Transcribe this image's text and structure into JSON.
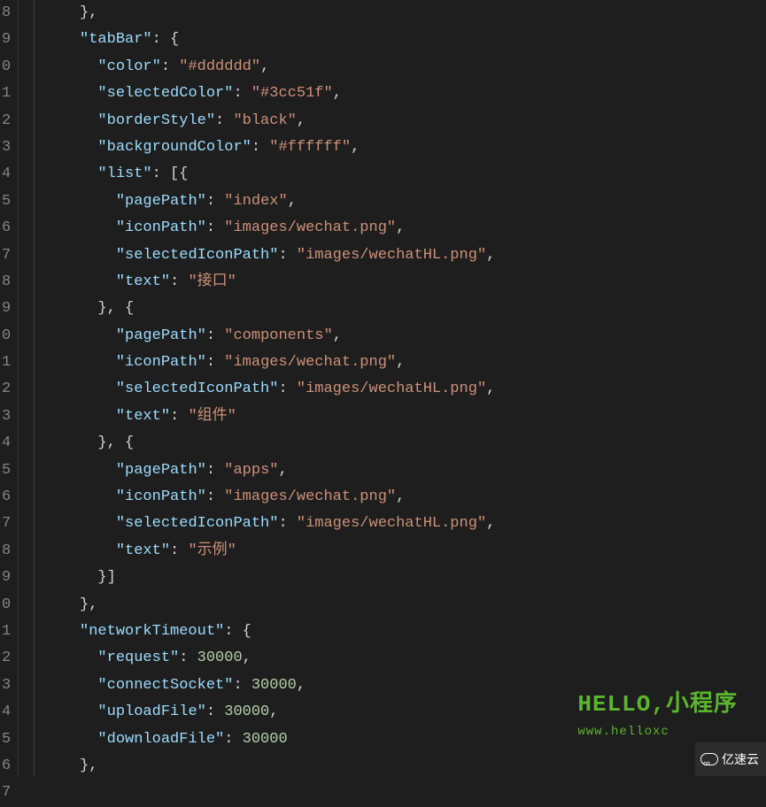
{
  "lineNumbers": [
    "8",
    "9",
    "0",
    "1",
    "2",
    "3",
    "4",
    "5",
    "6",
    "7",
    "8",
    "9",
    "0",
    "1",
    "2",
    "3",
    "4",
    "5",
    "6",
    "7",
    "8",
    "9",
    "0",
    "1",
    "2",
    "3",
    "4",
    "5",
    "6",
    "7"
  ],
  "watermark": {
    "title": "HELLO,小程序",
    "url": "www.helloxc",
    "badge": "亿速云"
  },
  "code": {
    "l0": "    },",
    "l1_key": "\"tabBar\"",
    "l1_rest": ": {",
    "l2_key": "\"color\"",
    "l2_val": "\"#dddddd\"",
    "l3_key": "\"selectedColor\"",
    "l3_val": "\"#3cc51f\"",
    "l4_key": "\"borderStyle\"",
    "l4_val": "\"black\"",
    "l5_key": "\"backgroundColor\"",
    "l5_val": "\"#ffffff\"",
    "l6_key": "\"list\"",
    "l6_rest": ": [{",
    "l7_key": "\"pagePath\"",
    "l7_val": "\"index\"",
    "l8_key": "\"iconPath\"",
    "l8_val": "\"images/wechat.png\"",
    "l9_key": "\"selectedIconPath\"",
    "l9_val": "\"images/wechatHL.png\"",
    "l10_key": "\"text\"",
    "l10_val": "\"接口\"",
    "l11": "      }, {",
    "l12_key": "\"pagePath\"",
    "l12_val": "\"components\"",
    "l13_key": "\"iconPath\"",
    "l13_val": "\"images/wechat.png\"",
    "l14_key": "\"selectedIconPath\"",
    "l14_val": "\"images/wechatHL.png\"",
    "l15_key": "\"text\"",
    "l15_val": "\"组件\"",
    "l16": "      }, {",
    "l17_key": "\"pagePath\"",
    "l17_val": "\"apps\"",
    "l18_key": "\"iconPath\"",
    "l18_val": "\"images/wechat.png\"",
    "l19_key": "\"selectedIconPath\"",
    "l19_val": "\"images/wechatHL.png\"",
    "l20_key": "\"text\"",
    "l20_val": "\"示例\"",
    "l21": "      }]",
    "l22": "    },",
    "l23_key": "\"networkTimeout\"",
    "l23_rest": ": {",
    "l24_key": "\"request\"",
    "l24_val": "30000",
    "l25_key": "\"connectSocket\"",
    "l25_val": "30000",
    "l26_key": "\"uploadFile\"",
    "l26_val": "30000",
    "l27_key": "\"downloadFile\"",
    "l27_val": "30000",
    "l28": "    },"
  }
}
